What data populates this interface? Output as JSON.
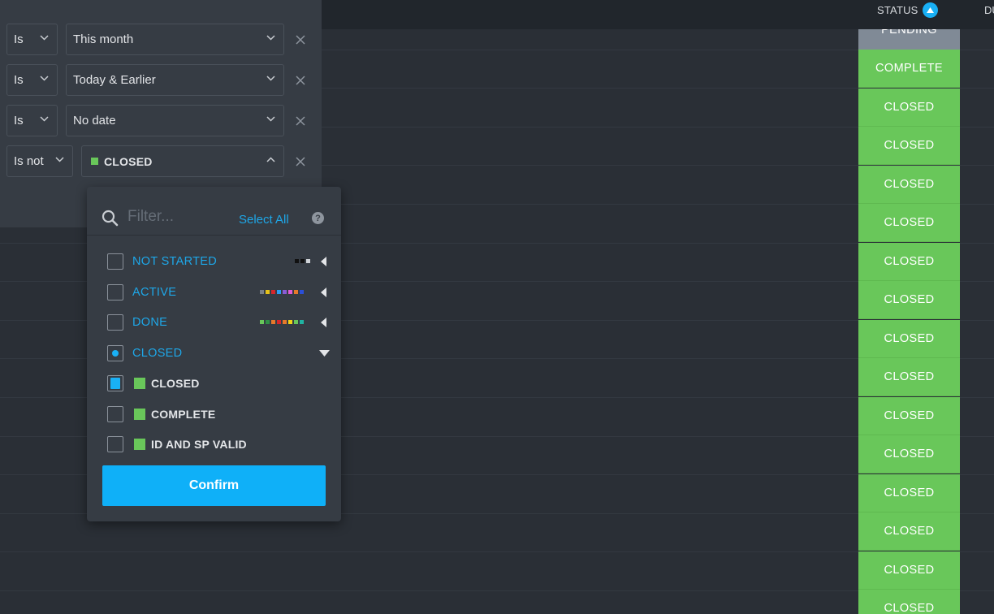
{
  "table": {
    "status_header": "STATUS",
    "next_header": "DU",
    "status_cells": [
      {
        "label": "PENDING",
        "color": "#808a96"
      },
      {
        "label": "COMPLETE",
        "color": "#69c75a"
      },
      {
        "label": "CLOSED",
        "color": "#69c75a"
      },
      {
        "label": "CLOSED",
        "color": "#69c75a"
      },
      {
        "label": "CLOSED",
        "color": "#69c75a"
      },
      {
        "label": "CLOSED",
        "color": "#69c75a"
      },
      {
        "label": "CLOSED",
        "color": "#69c75a"
      },
      {
        "label": "CLOSED",
        "color": "#69c75a"
      },
      {
        "label": "CLOSED",
        "color": "#69c75a"
      },
      {
        "label": "CLOSED",
        "color": "#69c75a"
      },
      {
        "label": "CLOSED",
        "color": "#69c75a"
      },
      {
        "label": "CLOSED",
        "color": "#69c75a"
      },
      {
        "label": "CLOSED",
        "color": "#69c75a"
      },
      {
        "label": "CLOSED",
        "color": "#69c75a"
      },
      {
        "label": "CLOSED",
        "color": "#69c75a"
      },
      {
        "label": "CLOSED",
        "color": "#69c75a"
      }
    ]
  },
  "filters": [
    {
      "operator": "Is",
      "value": "This month"
    },
    {
      "operator": "Is",
      "value": "Today & Earlier"
    },
    {
      "operator": "Is",
      "value": "No date"
    },
    {
      "operator": "Is not",
      "value": "CLOSED",
      "value_color": "#69c75a"
    }
  ],
  "dropdown": {
    "filter_placeholder": "Filter...",
    "filter_value": "",
    "select_all": "Select All",
    "help": "?",
    "groups": [
      {
        "label": "NOT STARTED",
        "checked": false,
        "swatches": [
          "#111111",
          "#111111",
          "#cfd3d8"
        ]
      },
      {
        "label": "ACTIVE",
        "checked": false,
        "swatches": [
          "#7a8088",
          "#e5c11a",
          "#d7262b",
          "#2a9df4",
          "#8a5cd6",
          "#e05bd6",
          "#e7792b",
          "#2b4fd8"
        ]
      },
      {
        "label": "DONE",
        "checked": false,
        "swatches": [
          "#69c75a",
          "#2f8f45",
          "#e7792b",
          "#d7262b",
          "#e7792b",
          "#f2d315",
          "#69c75a",
          "#20b3a2"
        ]
      },
      {
        "label": "CLOSED",
        "checked": "partial",
        "swatches": []
      }
    ],
    "sub_items": [
      {
        "label": "CLOSED",
        "checked": true,
        "color": "#69c75a"
      },
      {
        "label": "COMPLETE",
        "checked": false,
        "color": "#69c75a"
      },
      {
        "label": "ID AND SP VALID",
        "checked": false,
        "color": "#69c75a"
      }
    ],
    "confirm": "Confirm"
  }
}
